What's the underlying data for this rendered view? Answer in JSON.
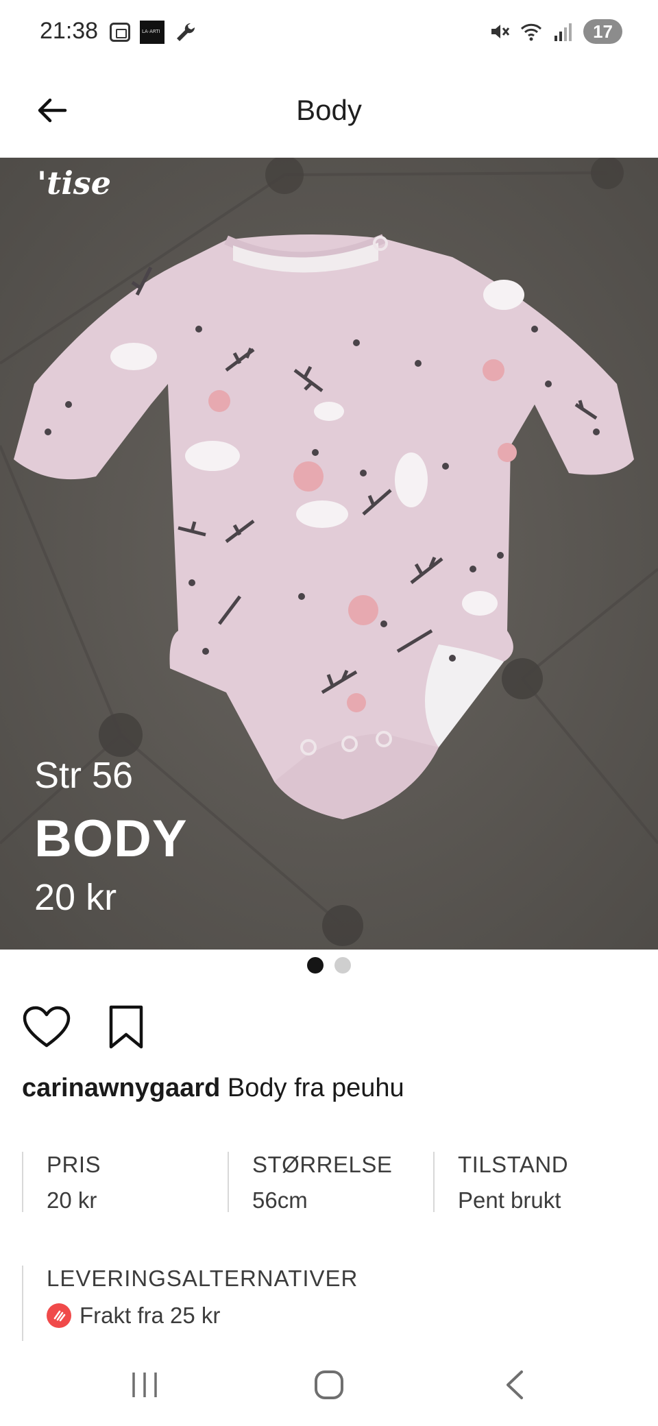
{
  "status_bar": {
    "time": "21:38",
    "app_icon_text": "LA·ARTI",
    "battery": "17"
  },
  "header": {
    "title": "Body",
    "back_icon": "arrow-left-icon"
  },
  "product_image": {
    "watermark": "'tise",
    "overlay_size": "Str 56",
    "overlay_title": "BODY",
    "overlay_price": "20 kr",
    "current_index": 1,
    "total_images": 2
  },
  "actions": {
    "like_icon": "heart-icon",
    "save_icon": "bookmark-icon"
  },
  "description": {
    "username": "carinawnygaard",
    "text": "Body fra peuhu"
  },
  "details": [
    {
      "label": "PRIS",
      "value": "20 kr"
    },
    {
      "label": "STØRRELSE",
      "value": "56cm"
    },
    {
      "label": "TILSTAND",
      "value": "Pent brukt"
    }
  ],
  "delivery": {
    "label": "LEVERINGSALTERNATIVER",
    "option": "Frakt fra 25 kr",
    "icon_color": "#f04a4a"
  },
  "nav": {
    "recents_icon": "recents-icon",
    "home_icon": "home-icon",
    "back_icon": "back-chevron-icon"
  }
}
